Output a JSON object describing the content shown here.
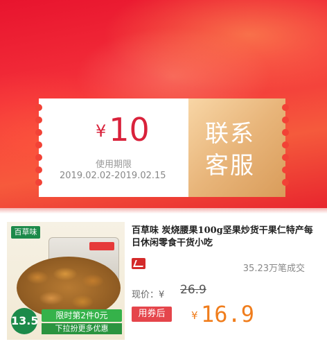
{
  "coupon": {
    "currency": "¥",
    "amount": "10",
    "valid_label": "使用期限",
    "valid_range": "2019.02.02-2019.02.15",
    "contact_label": "联系客服"
  },
  "product": {
    "brand": "百草味",
    "price_badge": "13.5",
    "promo": "限时第2件0元",
    "promo_sub": "下拉扮更多优惠",
    "title": "百草味 炭烧腰果100g坚果炒货干果仁特产每日休闲零食干货小吃",
    "sold": "35.23万笔成交",
    "orig_label": "现价：¥",
    "orig_price": "26.9",
    "coupon_tag": "用券后",
    "final_currency": "¥",
    "final_price": "16.9"
  },
  "colors": {
    "banner_red": "#e8142e",
    "price_orange": "#f07d1c",
    "amount_red": "#d9223b",
    "tag_red": "#e5454b"
  }
}
